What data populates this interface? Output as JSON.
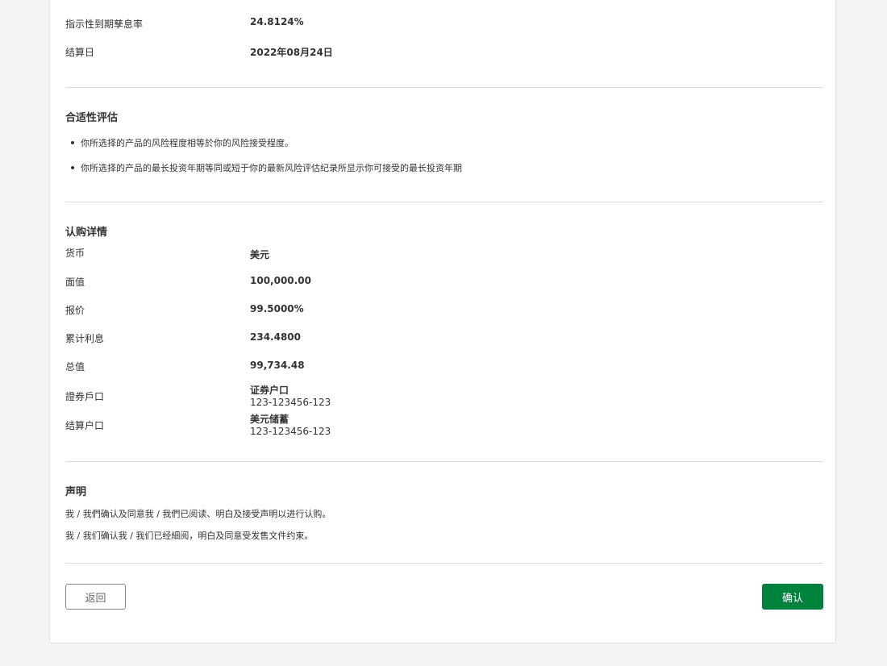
{
  "top": {
    "ytm_label": "指示性到期孳息率",
    "ytm_value": "24.8124%",
    "settle_label": "结算日",
    "settle_value": "2022年08月24日"
  },
  "suitability": {
    "title": "合适性评估",
    "items": [
      "你所选择的产品的风险程度相等於你的风险接受程度。",
      "你所选择的产品的最长投资年期等同或短于你的最新风险评估纪录所显示你可接受的最长投资年期"
    ]
  },
  "subscription": {
    "title": "认购详情",
    "rows": [
      {
        "label": "货币",
        "value": "美元"
      },
      {
        "label": "面值",
        "value": "100,000.00"
      },
      {
        "label": "报价",
        "value": "99.5000%"
      },
      {
        "label": "累计利息",
        "value": "234.4800"
      },
      {
        "label": "总值",
        "value": "99,734.48"
      }
    ],
    "securities_account": {
      "label": "證券戶口",
      "name": "证券户口",
      "number": "123-123456-123"
    },
    "settlement_account": {
      "label": "结算户口",
      "name": "美元储蓄",
      "number": "123-123456-123"
    }
  },
  "declaration": {
    "title": "声明",
    "lines": [
      "我 / 我們确认及同意我 / 我們已阅读、明白及接受声明以进行认购。",
      "我 / 我们确认我 / 我们已经細阅，明白及同意受发售文件约束。"
    ]
  },
  "buttons": {
    "back": "返回",
    "confirm": "确认"
  },
  "colors": {
    "confirm_bg": "#00843d",
    "page_bg": "#f4f4f4"
  }
}
